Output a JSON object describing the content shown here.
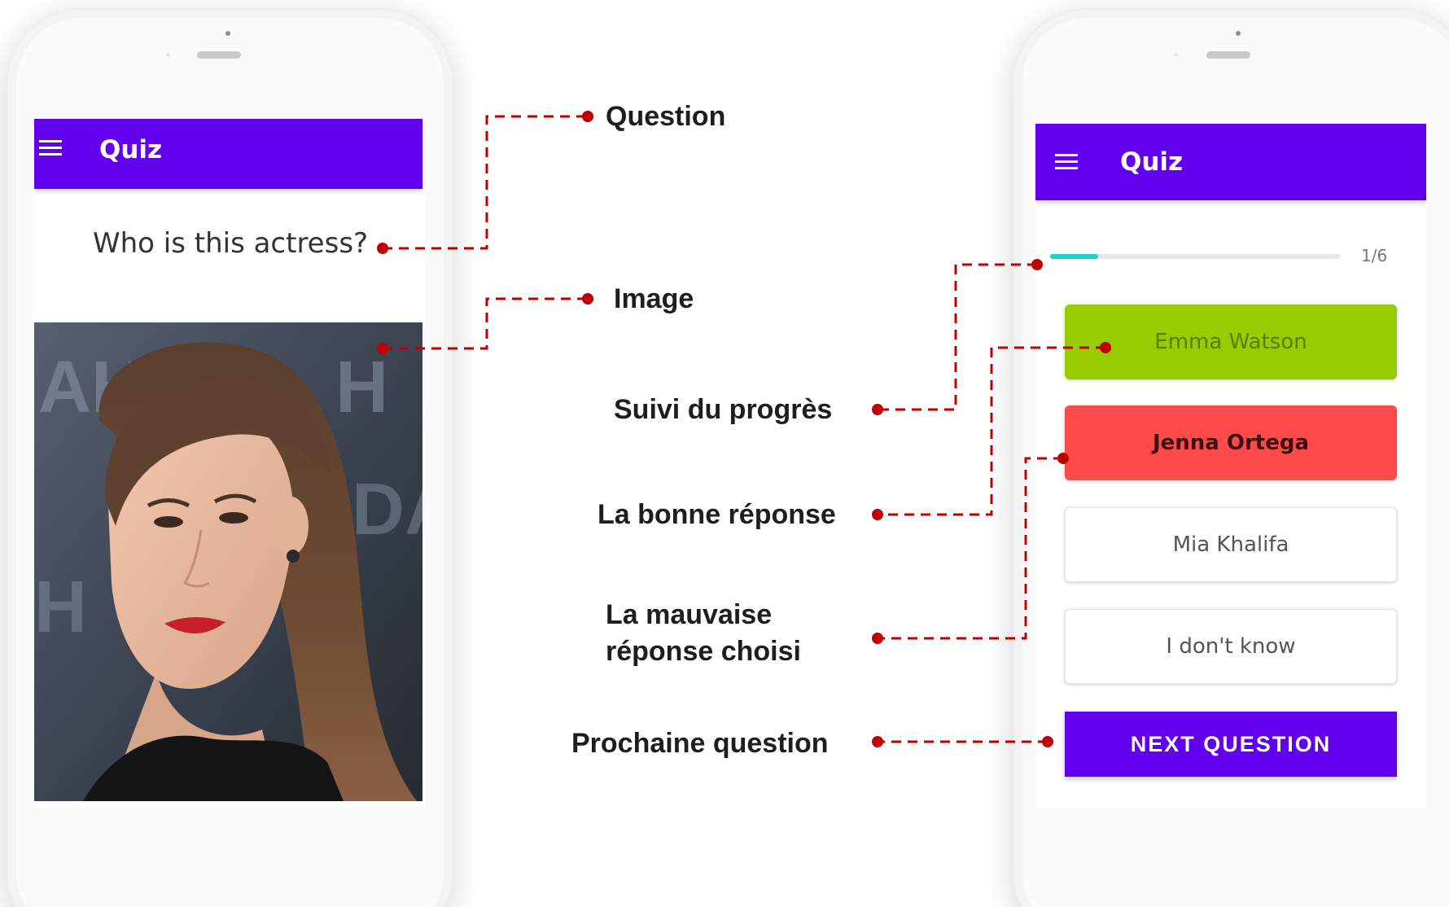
{
  "left_screen": {
    "app_title": "Quiz",
    "question": "Who is this actress?"
  },
  "right_screen": {
    "app_title": "Quiz",
    "progress": {
      "label": "1/6",
      "fraction": 0.167
    },
    "answers": [
      {
        "label": "Emma Watson",
        "state": "correct"
      },
      {
        "label": "Jenna Ortega",
        "state": "wrong-selected"
      },
      {
        "label": "Mia Khalifa",
        "state": "neutral"
      },
      {
        "label": "I don't know",
        "state": "neutral"
      }
    ],
    "next_button": "NEXT QUESTION"
  },
  "callouts": {
    "question": "Question",
    "image": "Image",
    "progress_tracking": "Suivi du progrès",
    "correct_answer": "La bonne réponse",
    "wrong_answer_line1": "La mauvaise",
    "wrong_answer_line2": "réponse choisi",
    "next_question": "Prochaine question"
  },
  "colors": {
    "app_bar": "#6200ee",
    "correct": "#99cc00",
    "wrong": "#ff4a4a",
    "progress": "#1dcfcf",
    "connector": "#c00000"
  },
  "icons": [
    "menu-icon",
    "menu-icon"
  ]
}
